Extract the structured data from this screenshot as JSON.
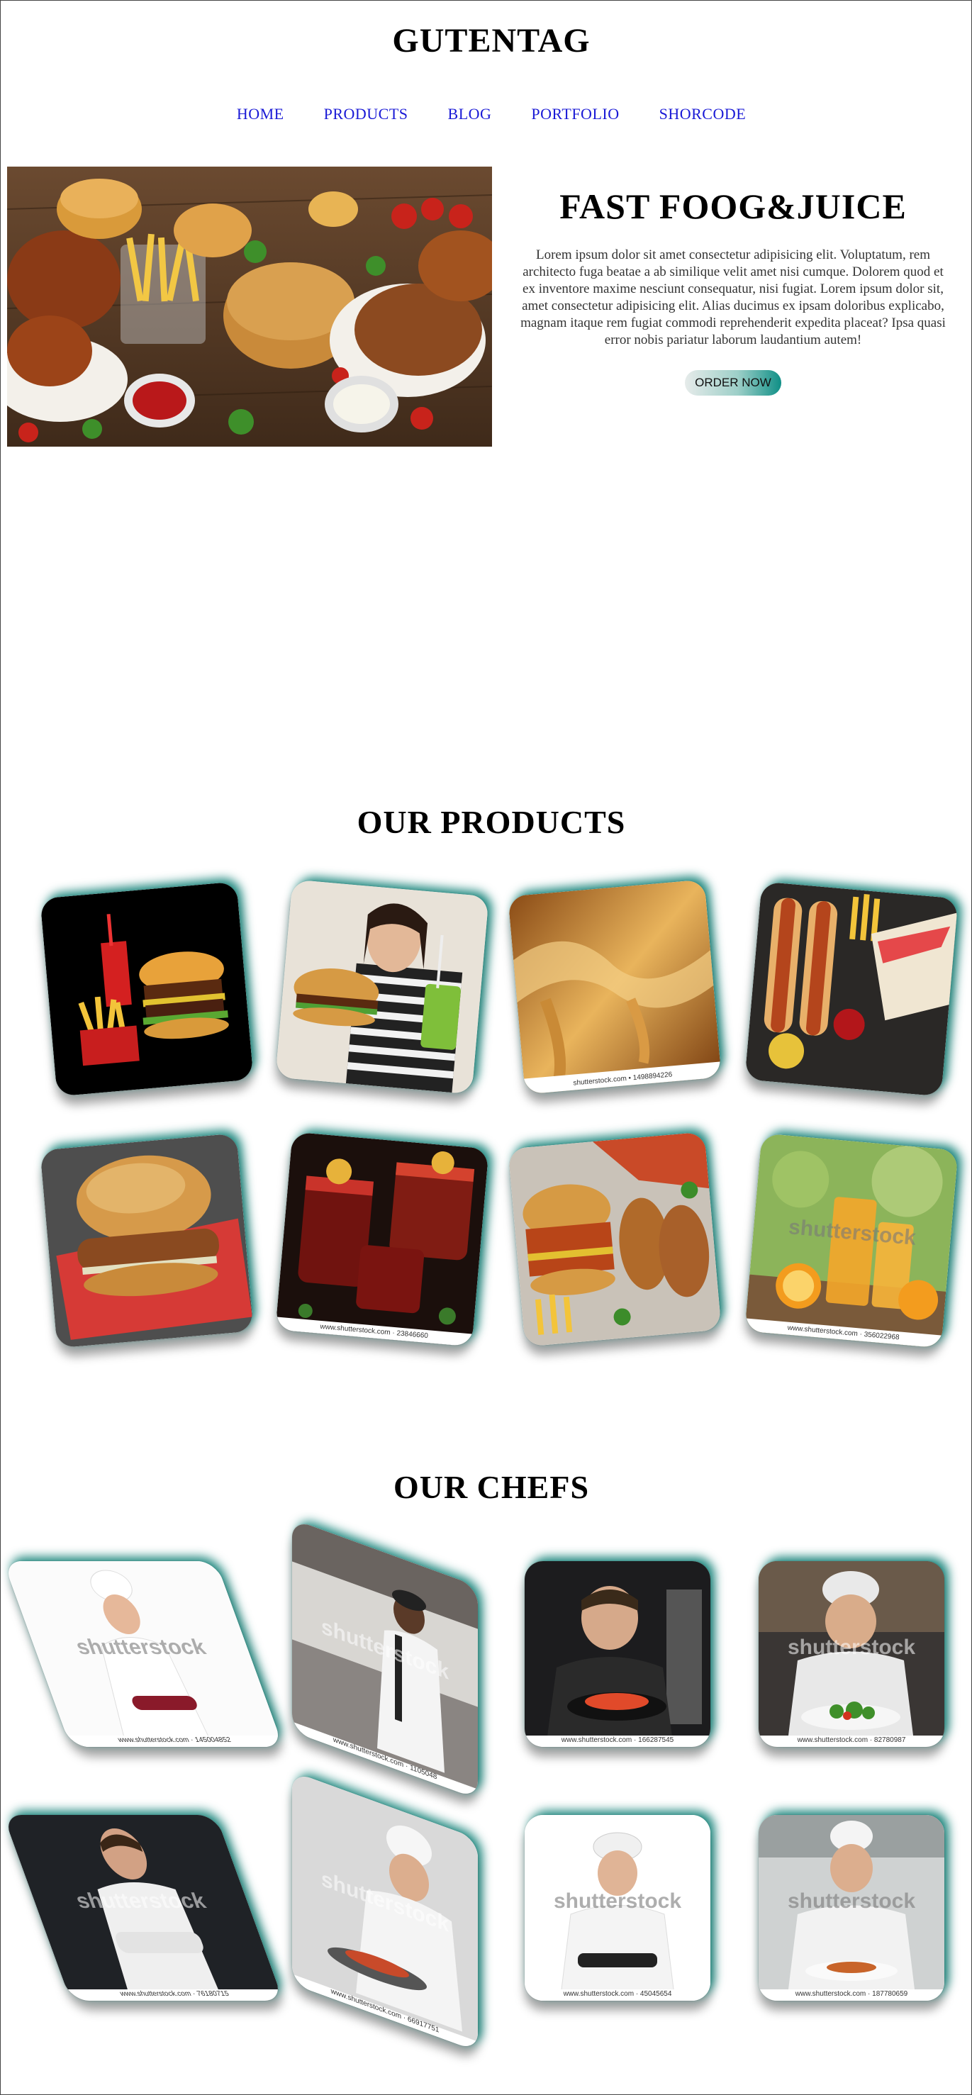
{
  "site": {
    "title": "GUTENTAG"
  },
  "nav": {
    "items": [
      "HOME",
      "PRODUCTS",
      "BLOG",
      "PORTFOLIO",
      "SHORCODE"
    ]
  },
  "hero": {
    "title": "FAST FOOG&JUICE",
    "text": "Lorem ipsum dolor sit amet consectetur adipisicing elit. Voluptatum, rem architecto fuga beatae a ab similique velit amet nisi cumque. Dolorem quod et ex inventore maxime nesciunt consequatur, nisi fugiat. Lorem ipsum dolor sit, amet consectetur adipisicing elit. Alias ducimus ex ipsam doloribus explicabo, magnam itaque rem fugiat commodi reprehenderit expedita placeat? Ipsa quasi error nobis pariatur laborum laudantium autem!",
    "button": "ORDER NOW",
    "image": "fast-food-platter"
  },
  "products": {
    "title": "OUR PRODUCTS",
    "items": [
      {
        "image": "burger-fries-soda",
        "watermark": ""
      },
      {
        "image": "woman-eating-burger",
        "watermark": ""
      },
      {
        "image": "liquid-caramel",
        "watermark": "shutterstock.com • 1498894226"
      },
      {
        "image": "hotdogs-fries-wrap",
        "watermark": ""
      },
      {
        "image": "chicken-burger",
        "watermark": ""
      },
      {
        "image": "tea-glasses",
        "watermark": "www.shutterstock.com · 23846660"
      },
      {
        "image": "burger-and-fried-chicken",
        "watermark": ""
      },
      {
        "image": "orange-juice",
        "watermark": "www.shutterstock.com · 356022968"
      }
    ]
  },
  "chefs": {
    "title": "OUR CHEFS",
    "items": [
      {
        "image": "chef-smiling-white-background",
        "watermark": "www.shutterstock.com · 145004852"
      },
      {
        "image": "chef-plating-in-kitchen",
        "watermark": "www.shutterstock.com · 1105048"
      },
      {
        "image": "chef-garnishing-dish",
        "watermark": "www.shutterstock.com · 166287545"
      },
      {
        "image": "chef-preparing-salad",
        "watermark": "www.shutterstock.com · 82780987"
      },
      {
        "image": "chef-arms-crossed-dark",
        "watermark": "www.shutterstock.com · 76180715"
      },
      {
        "image": "chef-seasoning-dish",
        "watermark": "www.shutterstock.com · 66917751"
      },
      {
        "image": "female-chef-smiling",
        "watermark": "www.shutterstock.com · 45045654"
      },
      {
        "image": "chef-holding-plate",
        "watermark": "www.shutterstock.com · 187780659"
      }
    ],
    "big_watermark": "shutterstock"
  }
}
